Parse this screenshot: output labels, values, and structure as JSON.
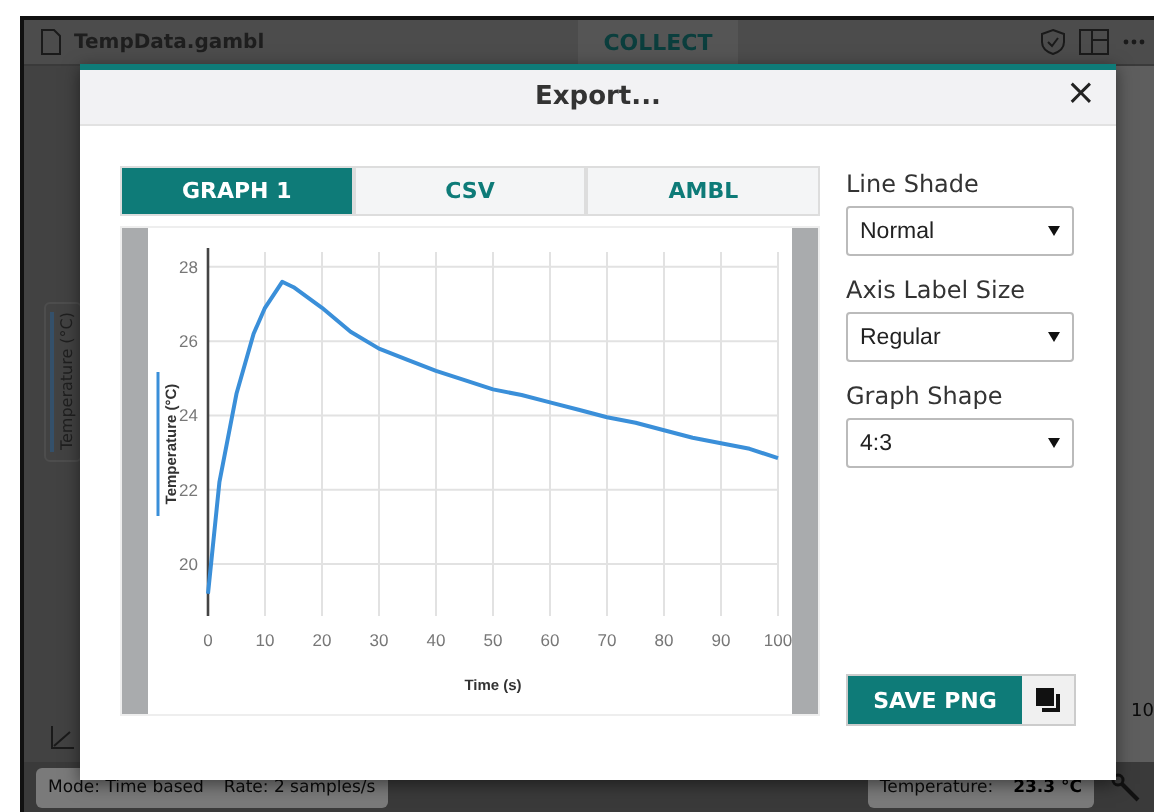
{
  "app": {
    "file_name": "TempData.gambl",
    "mode_tab": "COLLECT",
    "side_axis_label": "Temperature (°C)",
    "background_tick": "10",
    "status_bar": {
      "mode": "Mode: Time based",
      "rate": "Rate: 2 samples/s",
      "reading_label": "Temperature:",
      "reading_value": "23.3 °C"
    }
  },
  "dialog": {
    "title": "Export...",
    "close": "×",
    "tabs": [
      {
        "label": "GRAPH 1",
        "selected": true
      },
      {
        "label": "CSV",
        "selected": false
      },
      {
        "label": "AMBL",
        "selected": false
      }
    ],
    "chart_data": {
      "type": "line",
      "xlabel": "Time (s)",
      "ylabel": "Temperature (°C)",
      "x": [
        0,
        2,
        5,
        8,
        10,
        13,
        15,
        20,
        25,
        30,
        35,
        40,
        45,
        50,
        55,
        60,
        65,
        70,
        75,
        80,
        85,
        90,
        95,
        100
      ],
      "series": [
        {
          "color": "#3a8fd9",
          "values": [
            19.2,
            22.2,
            24.6,
            26.2,
            26.9,
            27.6,
            27.45,
            26.9,
            26.25,
            25.8,
            25.5,
            25.2,
            24.95,
            24.7,
            24.55,
            24.35,
            24.15,
            23.95,
            23.8,
            23.6,
            23.4,
            23.25,
            23.1,
            22.85
          ]
        }
      ],
      "xlim": [
        0,
        100
      ],
      "ylim": [
        18.6,
        28.4
      ],
      "xticks": [
        0,
        10,
        20,
        30,
        40,
        50,
        60,
        70,
        80,
        90,
        100
      ],
      "yticks": [
        20,
        22,
        24,
        26,
        28
      ],
      "grid": true
    },
    "options": [
      {
        "label": "Line Shade",
        "value": "Normal"
      },
      {
        "label": "Axis Label Size",
        "value": "Regular"
      },
      {
        "label": "Graph Shape",
        "value": "4:3"
      }
    ],
    "save_button": "SAVE PNG"
  }
}
